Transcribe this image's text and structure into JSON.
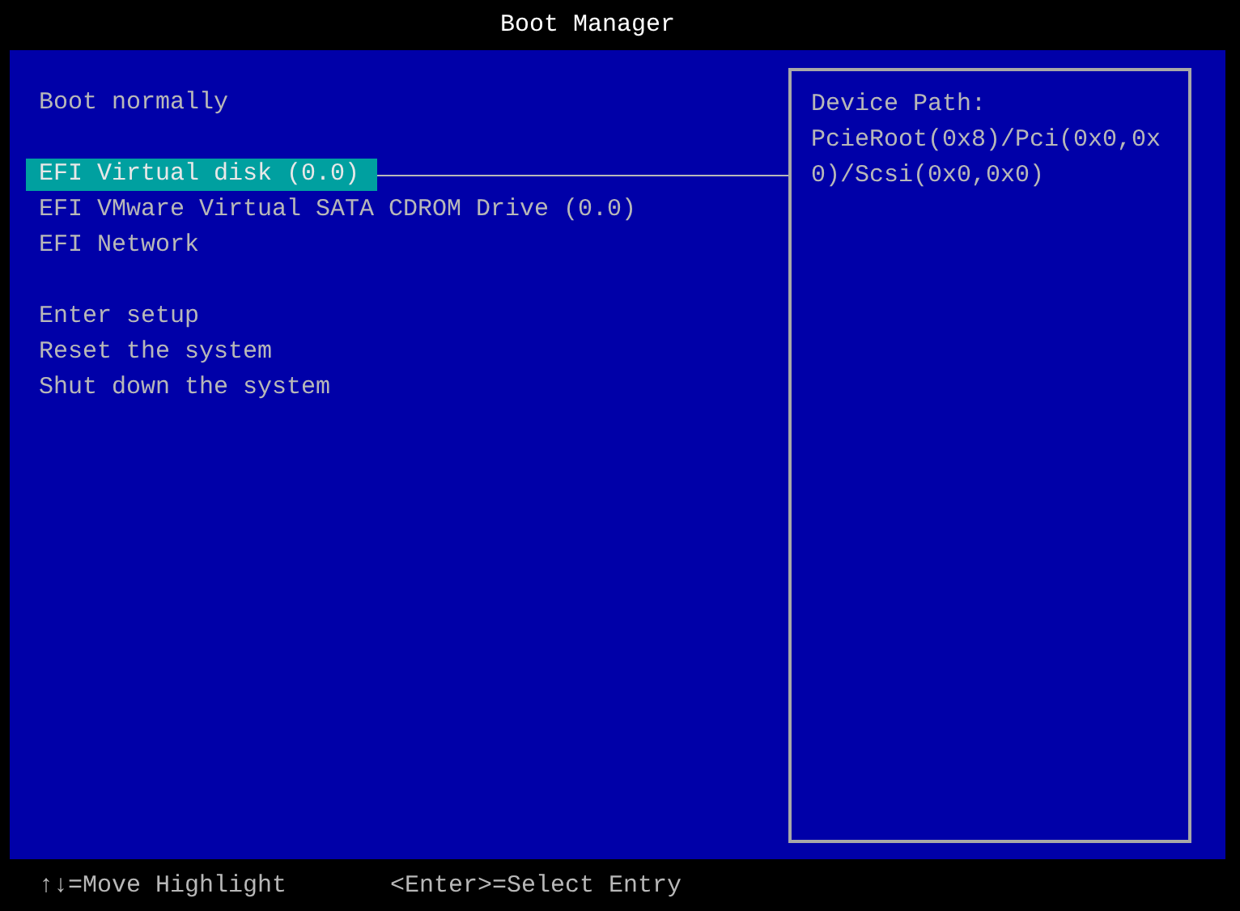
{
  "title": "Boot Manager",
  "menu": [
    {
      "items": [
        {
          "label": "Boot normally",
          "selected": false
        }
      ]
    },
    {
      "items": [
        {
          "label": "EFI Virtual disk (0.0)",
          "selected": true
        },
        {
          "label": "EFI VMware Virtual SATA CDROM Drive (0.0)",
          "selected": false
        },
        {
          "label": "EFI Network",
          "selected": false
        }
      ]
    },
    {
      "items": [
        {
          "label": "Enter setup",
          "selected": false
        },
        {
          "label": "Reset the system",
          "selected": false
        },
        {
          "label": "Shut down the system",
          "selected": false
        }
      ]
    }
  ],
  "details": {
    "label": "Device Path:",
    "value": "PcieRoot(0x8)/Pci(0x0,0x0)/Scsi(0x0,0x0)"
  },
  "help": [
    "↑↓=Move Highlight",
    "<Enter>=Select Entry"
  ]
}
